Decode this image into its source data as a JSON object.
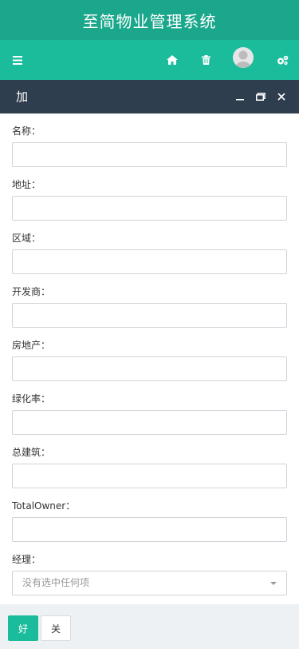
{
  "app": {
    "title": "至简物业管理系统"
  },
  "toolbar": {
    "icons": [
      "menu-icon",
      "home-icon",
      "trash-icon",
      "avatar",
      "settings-icon"
    ]
  },
  "dialog": {
    "title": "加",
    "controls": [
      "minimize-icon",
      "maximize-icon",
      "close-icon"
    ],
    "fields": [
      {
        "label": "名称：",
        "value": ""
      },
      {
        "label": "地址：",
        "value": ""
      },
      {
        "label": "区域：",
        "value": ""
      },
      {
        "label": "开发商：",
        "value": ""
      },
      {
        "label": "房地产：",
        "value": ""
      },
      {
        "label": "绿化率：",
        "value": ""
      },
      {
        "label": "总建筑：",
        "value": ""
      },
      {
        "label": "TotalOwner：",
        "value": ""
      }
    ],
    "manager": {
      "label": "经理：",
      "placeholder": "没有选中任何项"
    },
    "ok_label": "好",
    "close_label": "关"
  },
  "colors": {
    "header": "#1aa78b",
    "toolbar": "#1abc9c",
    "dialog_header": "#2f3e4e"
  }
}
